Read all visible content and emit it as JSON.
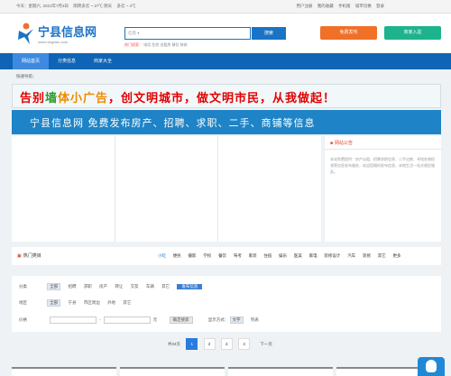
{
  "topbar": {
    "date": "今天：星期六, 2021年7月3日",
    "weather": "雨转多云 ~ 27℃ 阴天",
    "weather2": "多云 ~ 4℃",
    "links": [
      "用户注册",
      "我的收藏",
      "手机版",
      "城市切换",
      "登录"
    ]
  },
  "logo": {
    "title": "宁县信息网",
    "subtitle": "www.ningxian.com"
  },
  "search": {
    "placeholder": "信息 ▾",
    "button": "搜索",
    "hot_label": "热门搜索：",
    "hot_items": "电话 住房 出租房 餐饮 装修"
  },
  "header_buttons": {
    "post": "免费发布",
    "manage": "商家入驻"
  },
  "nav": {
    "items": [
      "网站首页",
      "分类信息",
      "商家大全"
    ]
  },
  "breadcrumb": "快速导航：",
  "banner1": {
    "p1": "告别",
    "p2": "墙",
    "p3": "体小广告",
    "p4": "，创文明城市，做文明市民，从我做起！"
  },
  "banner2": {
    "text": "宁县信息网   免费发布房产、招聘、求职、二手、商铺等信息"
  },
  "notice": {
    "title": "网站公告",
    "body": "本站免费提供：房产出租、招聘求职信息、二手出售、寻找失物招领等信息发布服务，欢迎您随时发布信息，本地生活一站式便民服务。"
  },
  "category_bar": {
    "title": "热门类目",
    "items": [
      "小吃",
      "便民",
      "摄影",
      "学校",
      "餐饮",
      "驾考",
      "家装",
      "住宿",
      "娱乐",
      "医美",
      "家电",
      "装修设计",
      "汽车",
      "装修",
      "其它",
      "更多"
    ]
  },
  "filters": {
    "row1": {
      "label": "分类",
      "selected": "全部",
      "options": [
        "招聘",
        "求职",
        "房产",
        "转让",
        "交友",
        "车辆",
        "其它"
      ],
      "button": "发布信息"
    },
    "row2": {
      "label": "地区",
      "selected": "全部",
      "options": [
        "宁县",
        "市区周边",
        "外地",
        "其它"
      ]
    },
    "row3": {
      "label": "价格",
      "unit": "元",
      "button": "确定搜索",
      "sort_label": "显示方式：",
      "sort_selected": "文字",
      "sort_option": "列表"
    }
  },
  "pager": {
    "total": "共34页",
    "pages": [
      "1",
      "2",
      "3",
      "4"
    ],
    "next": "下一页"
  }
}
